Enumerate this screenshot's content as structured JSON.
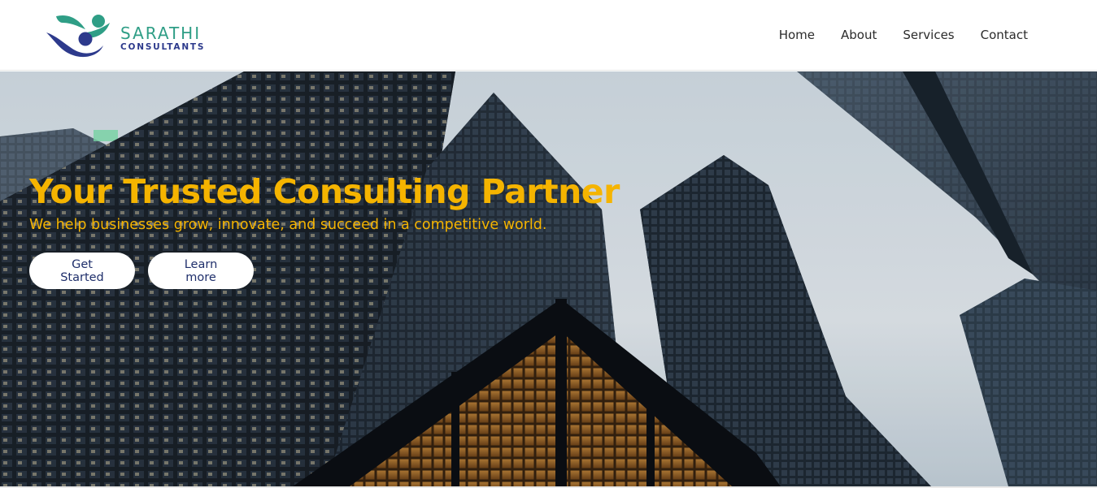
{
  "brand": {
    "name": "SARATHI",
    "tagline": "CONSULTANTS",
    "colors": {
      "primary": "#2f9e86",
      "secondary": "#2d3a8c"
    }
  },
  "nav": {
    "items": [
      {
        "label": "Home"
      },
      {
        "label": "About"
      },
      {
        "label": "Services"
      },
      {
        "label": "Contact"
      }
    ]
  },
  "hero": {
    "title": "Your Trusted Consulting Partner",
    "subtitle": "We help businesses grow, innovate, and succeed in a competitive world.",
    "accent_color": "#f5b400",
    "buttons": {
      "primary_label": "Get Started",
      "secondary_label": "Learn more"
    }
  }
}
